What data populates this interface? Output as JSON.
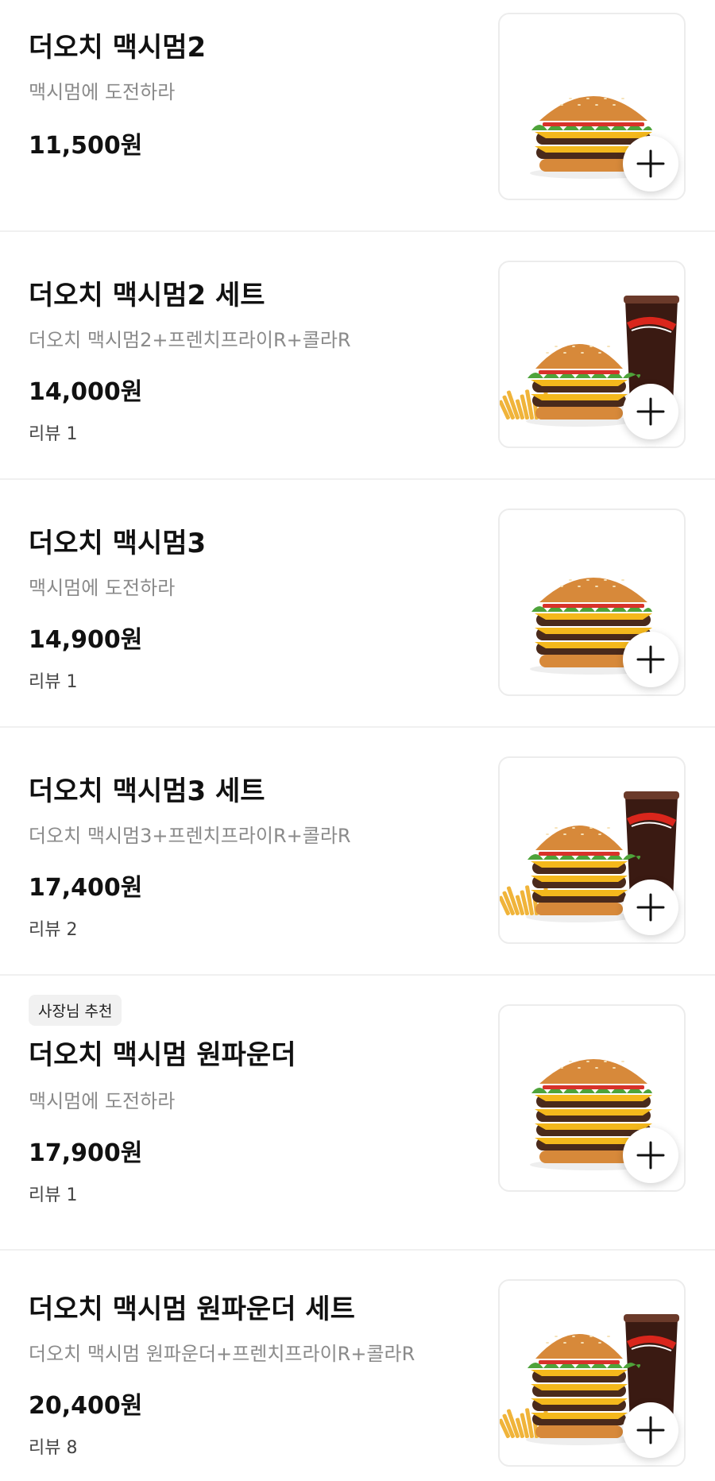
{
  "currency_suffix": "원",
  "icons": {
    "add": "plus-icon",
    "image": "burger-photo"
  },
  "colors": {
    "bun": "#d7893a",
    "lettuce": "#4ea33a",
    "cheese": "#f4b81c",
    "patty": "#4a2a1b",
    "cola": "#3a1a12",
    "fries": "#f0b43a",
    "label": "#d9261c"
  },
  "menu": [
    {
      "name": "더오치 맥시멈2",
      "description": "맥시멈에 도전하라",
      "price": "11,500원",
      "review": "",
      "badge": "",
      "image": {
        "patties": 2,
        "set": false
      }
    },
    {
      "name": "더오치 맥시멈2 세트",
      "description": "더오치 맥시멈2+프렌치프라이R+콜라R",
      "price": "14,000원",
      "review": "리뷰 1",
      "badge": "",
      "image": {
        "patties": 2,
        "set": true
      }
    },
    {
      "name": "더오치 맥시멈3",
      "description": "맥시멈에 도전하라",
      "price": "14,900원",
      "review": "리뷰 1",
      "badge": "",
      "image": {
        "patties": 3,
        "set": false
      }
    },
    {
      "name": "더오치 맥시멈3 세트",
      "description": "더오치 맥시멈3+프렌치프라이R+콜라R",
      "price": "17,400원",
      "review": "리뷰 2",
      "badge": "",
      "image": {
        "patties": 3,
        "set": true
      }
    },
    {
      "name": "더오치 맥시멈 원파운더",
      "description": "맥시멈에 도전하라",
      "price": "17,900원",
      "review": "리뷰 1",
      "badge": "사장님 추천",
      "image": {
        "patties": 4,
        "set": false
      }
    },
    {
      "name": "더오치 맥시멈 원파운더 세트",
      "description": "더오치 맥시멈 원파운더+프렌치프라이R+콜라R",
      "price": "20,400원",
      "review": "리뷰 8",
      "badge": "",
      "image": {
        "patties": 4,
        "set": true
      }
    }
  ]
}
